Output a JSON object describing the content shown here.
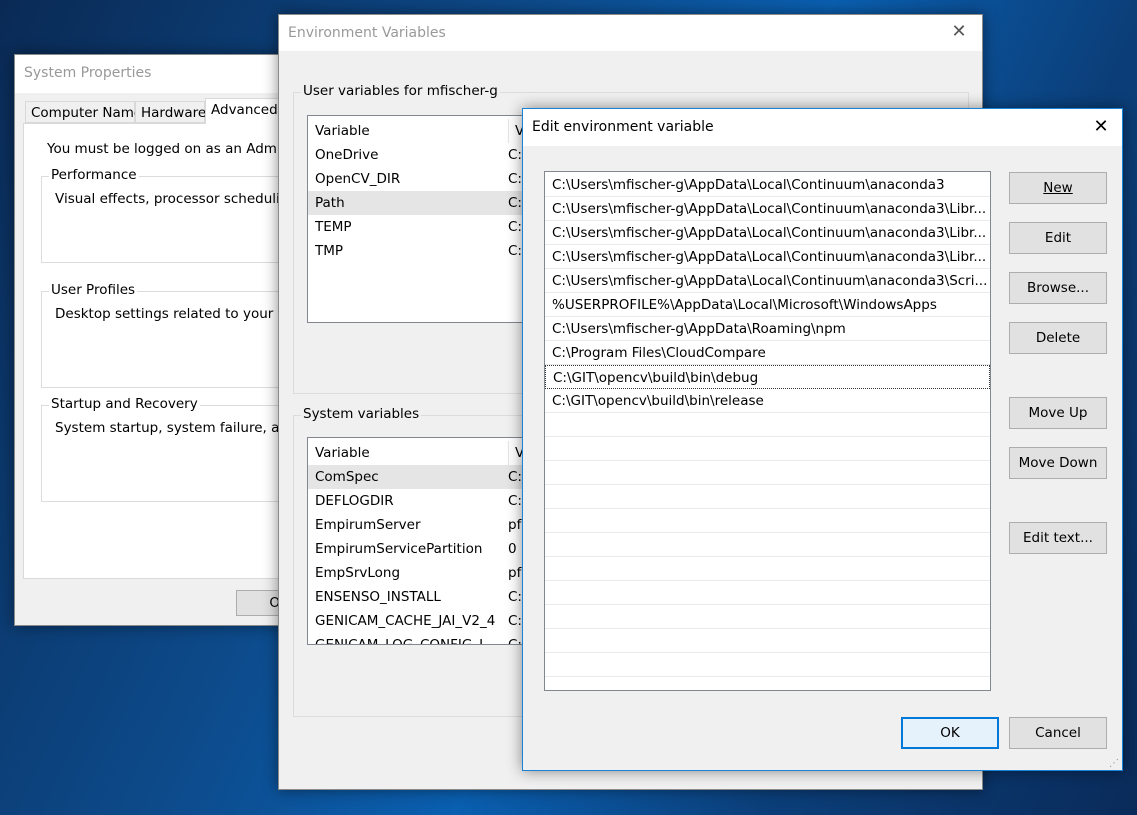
{
  "system_properties": {
    "title": "System Properties",
    "tabs": [
      "Computer Name",
      "Hardware",
      "Advanced"
    ],
    "active_tab": "Advanced",
    "admin_note": "You must be logged on as an Administr",
    "groups": [
      {
        "label": "Performance",
        "text": "Visual effects, processor scheduling, m"
      },
      {
        "label": "User Profiles",
        "text": "Desktop settings related to your sign-i"
      },
      {
        "label": "Startup and Recovery",
        "text": "System startup, system failure, and de"
      }
    ],
    "button_partial": "O"
  },
  "env_vars": {
    "title": "Environment Variables",
    "user_group_label": "User variables for mfischer-g",
    "system_group_label": "System variables",
    "columns": [
      "Variable",
      "Va"
    ],
    "user_rows": [
      [
        "OneDrive",
        "C:\\"
      ],
      [
        "OpenCV_DIR",
        "C:\\"
      ],
      [
        "Path",
        "C:\\"
      ],
      [
        "TEMP",
        "C:\\"
      ],
      [
        "TMP",
        "C:\\"
      ]
    ],
    "user_selected": "Path",
    "system_rows": [
      [
        "ComSpec",
        "C:\\"
      ],
      [
        "DEFLOGDIR",
        "C:\\"
      ],
      [
        "EmpirumServer",
        "pf"
      ],
      [
        "EmpirumServicePartition",
        "0"
      ],
      [
        "EmpSrvLong",
        "pf"
      ],
      [
        "ENSENSO_INSTALL",
        "C:\\"
      ],
      [
        "GENICAM_CACHE_JAI_V2_4",
        "C:\\"
      ],
      [
        "GENICAM_LOG_CONFIG_J",
        "C:\\"
      ]
    ],
    "system_selected": "ComSpec"
  },
  "edit_dialog": {
    "title": "Edit environment variable",
    "entries": [
      "C:\\Users\\mfischer-g\\AppData\\Local\\Continuum\\anaconda3",
      "C:\\Users\\mfischer-g\\AppData\\Local\\Continuum\\anaconda3\\Libr...",
      "C:\\Users\\mfischer-g\\AppData\\Local\\Continuum\\anaconda3\\Libr...",
      "C:\\Users\\mfischer-g\\AppData\\Local\\Continuum\\anaconda3\\Libr...",
      "C:\\Users\\mfischer-g\\AppData\\Local\\Continuum\\anaconda3\\Scri...",
      "%USERPROFILE%\\AppData\\Local\\Microsoft\\WindowsApps",
      "C:\\Users\\mfischer-g\\AppData\\Roaming\\npm",
      "C:\\Program Files\\CloudCompare",
      "C:\\GIT\\opencv\\build\\bin\\debug",
      "C:\\GIT\\opencv\\build\\bin\\release"
    ],
    "focused_entry": "C:\\GIT\\opencv\\build\\bin\\debug",
    "buttons": {
      "new": "New",
      "edit": "Edit",
      "browse": "Browse...",
      "delete": "Delete",
      "move_up": "Move Up",
      "move_down": "Move Down",
      "edit_text": "Edit text...",
      "ok": "OK",
      "cancel": "Cancel"
    }
  },
  "colors": {
    "accent": "#0078d7",
    "selection": "#e5e5e5"
  }
}
